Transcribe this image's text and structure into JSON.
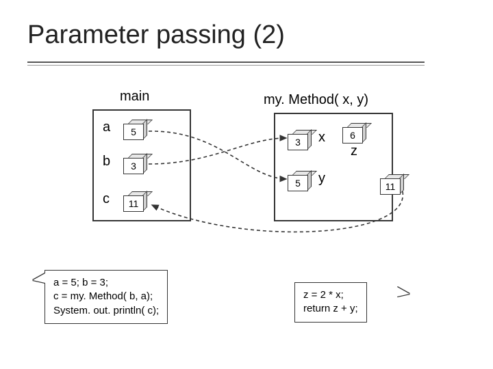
{
  "title": "Parameter passing (2)",
  "main": {
    "heading": "main",
    "vars": {
      "a": {
        "label": "a",
        "value": "5"
      },
      "b": {
        "label": "b",
        "value": "3"
      },
      "c": {
        "label": "c",
        "value": "11"
      }
    }
  },
  "method": {
    "heading": "my. Method( x, y)",
    "vars": {
      "x": {
        "label": "x",
        "value": "3"
      },
      "y": {
        "label": "y",
        "value": "5"
      },
      "z": {
        "label": "z",
        "value": "6"
      },
      "ret": {
        "value": "11"
      }
    }
  },
  "callouts": {
    "left": "a = 5; b = 3;\nc = my. Method( b, a);\nSystem. out. println( c);",
    "right": "z = 2 * x;\nreturn z + y;"
  }
}
